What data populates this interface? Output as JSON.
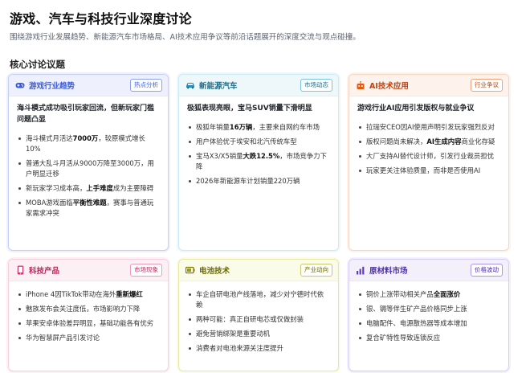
{
  "page": {
    "title": "游戏、汽车与科技行业深度讨论",
    "subtitle": "围绕游戏行业发展趋势、新能源汽车市场格局、AI技术应用争议等前沿话题展开的深度交流与观点碰撞。",
    "section_title": "核心讨论议题"
  },
  "colors": {
    "blue": "#3b5bdb",
    "green": "#2f9e44",
    "orange": "#e8590c",
    "pink": "#d6336c",
    "olive": "#8a8a00",
    "purple": "#5f3dc4"
  },
  "cards": [
    {
      "title": "游戏行业趋势",
      "tag": "热点分析",
      "icon": "gamepad-icon",
      "headline": "海斗模式成功吸引玩家回流，但新玩家门槛问题凸显",
      "items": [
        {
          "pre": "海斗模式月活达",
          "bold": "7000万",
          "post": "，较原模式增长10%"
        },
        {
          "pre": "普通大乱斗月活从9000万降至3000万，用户明显迁移",
          "bold": "",
          "post": ""
        },
        {
          "pre": "新玩家学习成本高，",
          "bold": "上手难度",
          "post": "成为主要障碍"
        },
        {
          "pre": "MOBA游戏面临",
          "bold": "平衡性难题",
          "post": "，赛事与普通玩家需求冲突"
        }
      ]
    },
    {
      "title": "新能源汽车",
      "tag": "市场动态",
      "icon": "car-icon",
      "headline": "极狐表现亮眼，宝马SUV销量下滑明显",
      "items": [
        {
          "pre": "极狐年销量",
          "bold": "16万辆",
          "post": "，主要来自网约车市场"
        },
        {
          "pre": "用户体验优于埃安和北汽传统车型",
          "bold": "",
          "post": ""
        },
        {
          "pre": "宝马X3/X5销量",
          "bold": "大跌12.5%",
          "post": "，市场竞争力下降"
        },
        {
          "pre": "2026年新能源车计划销量220万辆",
          "bold": "",
          "post": ""
        }
      ]
    },
    {
      "title": "AI技术应用",
      "tag": "行业争议",
      "icon": "robot-icon",
      "headline": "游戏行业AI应用引发版权与就业争议",
      "items": [
        {
          "pre": "拉瑞安CEO因AI使用声明引发玩家强烈反对",
          "bold": "",
          "post": ""
        },
        {
          "pre": "版权问题尚未解决，",
          "bold": "AI生成内容",
          "post": "商业化存疑"
        },
        {
          "pre": "大厂支持AI替代设计师，引发行业裁员担忧",
          "bold": "",
          "post": ""
        },
        {
          "pre": "玩家更关注体验质量，而非是否使用AI",
          "bold": "",
          "post": ""
        }
      ]
    },
    {
      "title": "科技产品",
      "tag": "市场现象",
      "icon": "phone-icon",
      "headline": "",
      "items": [
        {
          "pre": "iPhone 4因TikTok带动在海外",
          "bold": "重新爆红",
          "post": ""
        },
        {
          "pre": "魅族发布会关注度低，市场影响力下降",
          "bold": "",
          "post": ""
        },
        {
          "pre": "苹果安卓体验差异明显，基础功能各有优劣",
          "bold": "",
          "post": ""
        },
        {
          "pre": "华为智慧屏产品引发讨论",
          "bold": "",
          "post": ""
        }
      ]
    },
    {
      "title": "电池技术",
      "tag": "产业动向",
      "icon": "battery-icon",
      "headline": "",
      "items": [
        {
          "pre": "车企自研电池产线落地，减少对宁德时代依赖",
          "bold": "",
          "post": ""
        },
        {
          "pre": "两种可能：真正自研电芯或仅做封装",
          "bold": "",
          "post": ""
        },
        {
          "pre": "避免营销绑架是重要动机",
          "bold": "",
          "post": ""
        },
        {
          "pre": "消费者对电池来源关注度提升",
          "bold": "",
          "post": ""
        }
      ]
    },
    {
      "title": "原材料市场",
      "tag": "价格波动",
      "icon": "chart-icon",
      "headline": "",
      "items": [
        {
          "pre": "铜价上涨带动相关产品",
          "bold": "全面涨价",
          "post": ""
        },
        {
          "pre": "银、镉等伴生矿产品价格同步上涨",
          "bold": "",
          "post": ""
        },
        {
          "pre": "电脑配件、电源散热器等成本增加",
          "bold": "",
          "post": ""
        },
        {
          "pre": "复合矿特性导致连锁反应",
          "bold": "",
          "post": ""
        }
      ]
    }
  ]
}
